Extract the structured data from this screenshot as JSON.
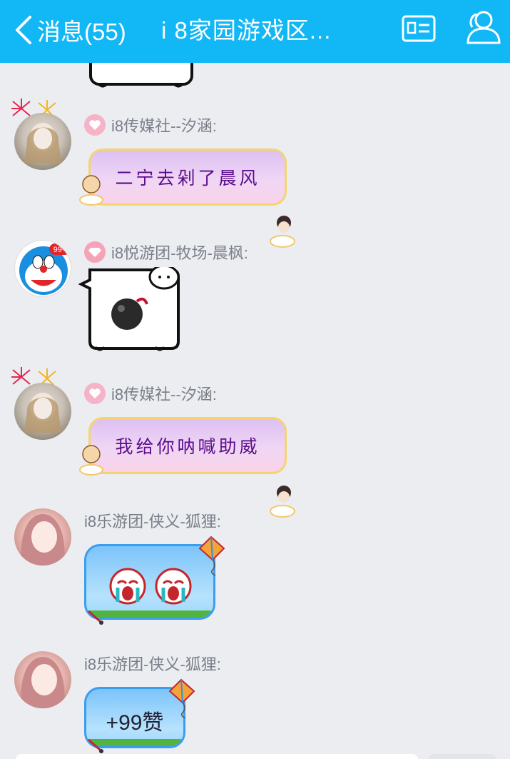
{
  "header": {
    "back_label": "消息(55)",
    "title": "i 8家园游戏区...",
    "icons": {
      "back": "chevron-left-icon",
      "card": "id-card-icon",
      "profile": "group-profile-icon"
    },
    "bg_color": "#12b7f5"
  },
  "messages": [
    {
      "sender": "i8传媒社--汐涵:",
      "badge": "heart-badge",
      "text": "二宁去剁了晨风"
    },
    {
      "sender": "i8悦游团-牧场-晨枫:",
      "badge": "diamond-badge",
      "sticker": "bomb-sticker"
    },
    {
      "sender": "i8传媒社--汐涵:",
      "badge": "heart-badge",
      "text": "我给你呐喊助威"
    },
    {
      "sender": "i8乐游团-侠义-狐狸:",
      "sticker": "crying-cat-emoji"
    },
    {
      "sender": "i8乐游团-侠义-狐狸:",
      "text": "+99赞"
    }
  ]
}
